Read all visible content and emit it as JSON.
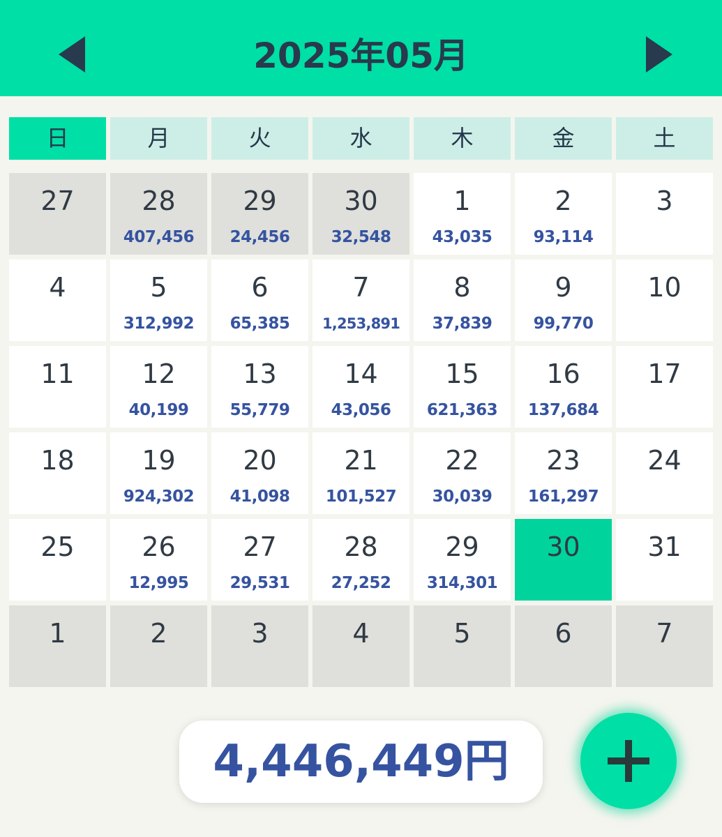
{
  "header": {
    "title": "2025年05月",
    "prev_icon": "triangle-left-icon",
    "next_icon": "triangle-right-icon"
  },
  "weekdays": [
    "日",
    "月",
    "火",
    "水",
    "木",
    "金",
    "土"
  ],
  "weeks": [
    [
      {
        "day": "27",
        "amount": "",
        "other_month": true
      },
      {
        "day": "28",
        "amount": "407,456",
        "other_month": true
      },
      {
        "day": "29",
        "amount": "24,456",
        "other_month": true
      },
      {
        "day": "30",
        "amount": "32,548",
        "other_month": true
      },
      {
        "day": "1",
        "amount": "43,035"
      },
      {
        "day": "2",
        "amount": "93,114"
      },
      {
        "day": "3",
        "amount": ""
      }
    ],
    [
      {
        "day": "4",
        "amount": ""
      },
      {
        "day": "5",
        "amount": "312,992"
      },
      {
        "day": "6",
        "amount": "65,385"
      },
      {
        "day": "7",
        "amount": "1,253,891"
      },
      {
        "day": "8",
        "amount": "37,839"
      },
      {
        "day": "9",
        "amount": "99,770"
      },
      {
        "day": "10",
        "amount": ""
      }
    ],
    [
      {
        "day": "11",
        "amount": ""
      },
      {
        "day": "12",
        "amount": "40,199"
      },
      {
        "day": "13",
        "amount": "55,779"
      },
      {
        "day": "14",
        "amount": "43,056"
      },
      {
        "day": "15",
        "amount": "621,363"
      },
      {
        "day": "16",
        "amount": "137,684"
      },
      {
        "day": "17",
        "amount": ""
      }
    ],
    [
      {
        "day": "18",
        "amount": ""
      },
      {
        "day": "19",
        "amount": "924,302"
      },
      {
        "day": "20",
        "amount": "41,098"
      },
      {
        "day": "21",
        "amount": "101,527"
      },
      {
        "day": "22",
        "amount": "30,039"
      },
      {
        "day": "23",
        "amount": "161,297"
      },
      {
        "day": "24",
        "amount": ""
      }
    ],
    [
      {
        "day": "25",
        "amount": ""
      },
      {
        "day": "26",
        "amount": "12,995"
      },
      {
        "day": "27",
        "amount": "29,531"
      },
      {
        "day": "28",
        "amount": "27,252"
      },
      {
        "day": "29",
        "amount": "314,301"
      },
      {
        "day": "30",
        "amount": "",
        "selected": true
      },
      {
        "day": "31",
        "amount": ""
      }
    ],
    [
      {
        "day": "1",
        "amount": "",
        "other_month": true
      },
      {
        "day": "2",
        "amount": "",
        "other_month": true
      },
      {
        "day": "3",
        "amount": "",
        "other_month": true
      },
      {
        "day": "4",
        "amount": "",
        "other_month": true
      },
      {
        "day": "5",
        "amount": "",
        "other_month": true
      },
      {
        "day": "6",
        "amount": "",
        "other_month": true
      },
      {
        "day": "7",
        "amount": "",
        "other_month": true
      }
    ]
  ],
  "total": "4,446,449円",
  "add_button": {
    "icon": "plus-icon"
  },
  "colors": {
    "accent": "#00dfa5",
    "selected": "#00d49c",
    "weekday_bg": "#cdeee6",
    "other_month_bg": "#dfdfdb",
    "amount_text": "#3553a0",
    "title_text": "#283a4e"
  }
}
